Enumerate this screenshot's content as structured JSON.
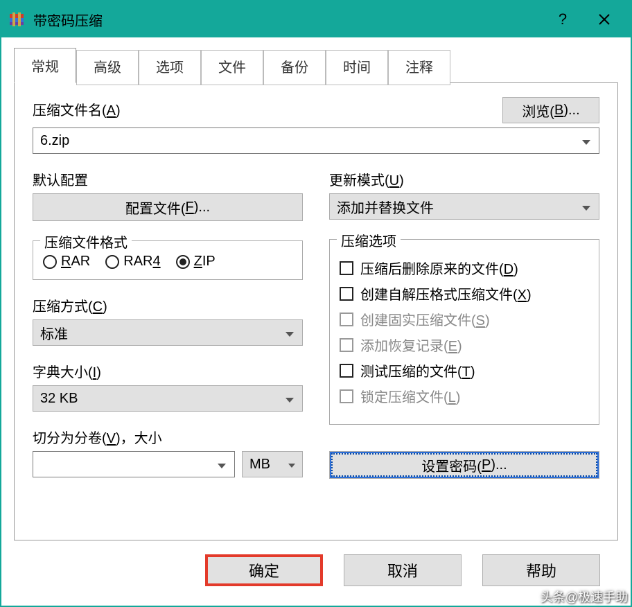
{
  "window": {
    "title": "带密码压缩"
  },
  "tabs": [
    "常规",
    "高级",
    "选项",
    "文件",
    "备份",
    "时间",
    "注释"
  ],
  "archive": {
    "label_pre": "压缩文件名(",
    "label_key": "A",
    "label_post": ")",
    "value": "6.zip",
    "browse_pre": "浏览(",
    "browse_key": "B",
    "browse_post": ")..."
  },
  "profile": {
    "group": "默认配置",
    "button_pre": "配置文件(",
    "button_key": "F",
    "button_post": ")..."
  },
  "update": {
    "label_pre": "更新模式(",
    "label_key": "U",
    "label_post": ")",
    "value": "添加并替换文件"
  },
  "format": {
    "legend": "压缩文件格式",
    "options": [
      {
        "label_pre": "",
        "label_key": "R",
        "label_post": "AR",
        "checked": false
      },
      {
        "label_pre": "RAR",
        "label_key": "4",
        "label_post": "",
        "checked": false,
        "rar4": true
      },
      {
        "label_pre": "",
        "label_key": "Z",
        "label_post": "IP",
        "checked": true
      }
    ]
  },
  "method": {
    "label_pre": "压缩方式(",
    "label_key": "C",
    "label_post": ")",
    "value": "标准"
  },
  "dict": {
    "label_pre": "字典大小(",
    "label_key": "I",
    "label_post": ")",
    "value": "32 KB"
  },
  "split": {
    "label_pre": "切分为分卷(",
    "label_key": "V",
    "label_post": ")，大小",
    "value": "",
    "unit": "MB"
  },
  "options": {
    "legend": "压缩选项",
    "items": [
      {
        "pre": "压缩后删除原来的文件(",
        "key": "D",
        "post": ")",
        "disabled": false
      },
      {
        "pre": "创建自解压格式压缩文件(",
        "key": "X",
        "post": ")",
        "disabled": false
      },
      {
        "pre": "创建固实压缩文件(",
        "key": "S",
        "post": ")",
        "disabled": true
      },
      {
        "pre": "添加恢复记录(",
        "key": "E",
        "post": ")",
        "disabled": true
      },
      {
        "pre": "测试压缩的文件(",
        "key": "T",
        "post": ")",
        "disabled": false
      },
      {
        "pre": "锁定压缩文件(",
        "key": "L",
        "post": ")",
        "disabled": true
      }
    ]
  },
  "password": {
    "button_pre": "设置密码(",
    "button_key": "P",
    "button_post": ")..."
  },
  "footer": {
    "ok": "确定",
    "cancel": "取消",
    "help": "帮助"
  },
  "watermark": "头条@极速手助"
}
